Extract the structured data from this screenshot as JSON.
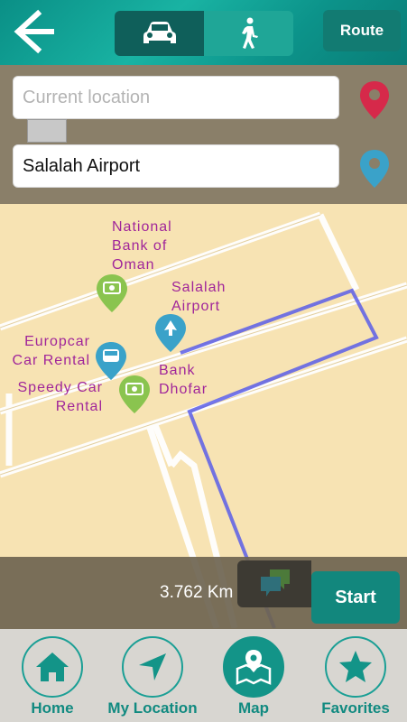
{
  "header": {
    "route_label": "Route",
    "modes": [
      {
        "name": "car-icon",
        "active": true
      },
      {
        "name": "walk-icon",
        "active": false
      }
    ]
  },
  "search": {
    "from_placeholder": "Current location",
    "to_value": "Salalah Airport"
  },
  "map": {
    "pois": [
      {
        "label": "National\nBank of\nOman",
        "icon": "bank-icon"
      },
      {
        "label": "Salalah\nAirport",
        "icon": "airport-icon"
      },
      {
        "label": "Europcar\nCar Rental",
        "icon": "car-rental-icon"
      },
      {
        "label": "Speedy Car\nRental",
        "icon": "bank-icon"
      },
      {
        "label": "Bank\nDhofar",
        "icon": "bank-icon"
      }
    ],
    "route_color": "#5b5ee8"
  },
  "trip": {
    "distance": "3.762 Km",
    "start_label": "Start"
  },
  "tabs": [
    {
      "label": "Home",
      "icon": "home-icon",
      "active": false
    },
    {
      "label": "My Location",
      "icon": "location-arrow-icon",
      "active": false
    },
    {
      "label": "Map",
      "icon": "map-icon",
      "active": true
    },
    {
      "label": "Favorites",
      "icon": "star-icon",
      "active": false
    }
  ],
  "colors": {
    "accent": "#139488",
    "poi_text": "#a0259a",
    "origin_pin": "#d6294a",
    "destination_pin": "#3aa2c9"
  }
}
